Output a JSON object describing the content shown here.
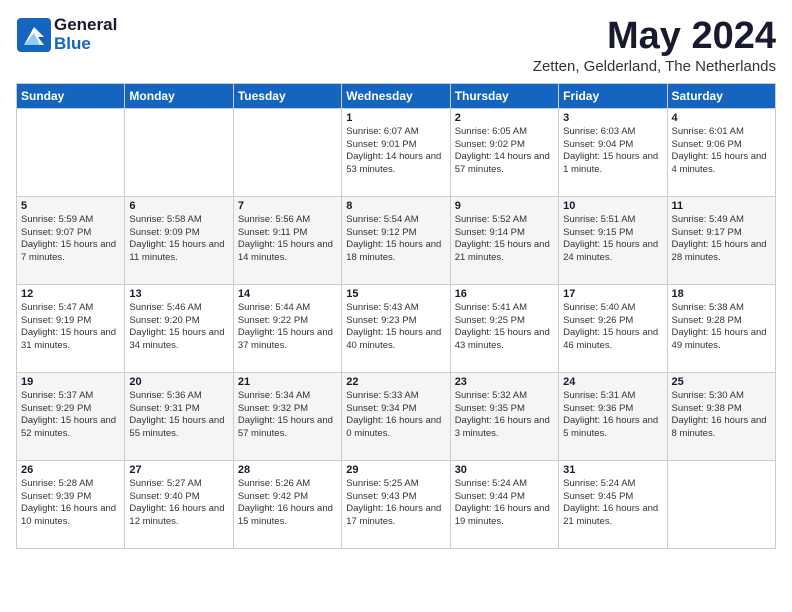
{
  "logo": {
    "general": "General",
    "blue": "Blue"
  },
  "title": "May 2024",
  "location": "Zetten, Gelderland, The Netherlands",
  "days_of_week": [
    "Sunday",
    "Monday",
    "Tuesday",
    "Wednesday",
    "Thursday",
    "Friday",
    "Saturday"
  ],
  "weeks": [
    [
      {
        "day": "",
        "info": ""
      },
      {
        "day": "",
        "info": ""
      },
      {
        "day": "",
        "info": ""
      },
      {
        "day": "1",
        "info": "Sunrise: 6:07 AM\nSunset: 9:01 PM\nDaylight: 14 hours and 53 minutes."
      },
      {
        "day": "2",
        "info": "Sunrise: 6:05 AM\nSunset: 9:02 PM\nDaylight: 14 hours and 57 minutes."
      },
      {
        "day": "3",
        "info": "Sunrise: 6:03 AM\nSunset: 9:04 PM\nDaylight: 15 hours and 1 minute."
      },
      {
        "day": "4",
        "info": "Sunrise: 6:01 AM\nSunset: 9:06 PM\nDaylight: 15 hours and 4 minutes."
      }
    ],
    [
      {
        "day": "5",
        "info": "Sunrise: 5:59 AM\nSunset: 9:07 PM\nDaylight: 15 hours and 7 minutes."
      },
      {
        "day": "6",
        "info": "Sunrise: 5:58 AM\nSunset: 9:09 PM\nDaylight: 15 hours and 11 minutes."
      },
      {
        "day": "7",
        "info": "Sunrise: 5:56 AM\nSunset: 9:11 PM\nDaylight: 15 hours and 14 minutes."
      },
      {
        "day": "8",
        "info": "Sunrise: 5:54 AM\nSunset: 9:12 PM\nDaylight: 15 hours and 18 minutes."
      },
      {
        "day": "9",
        "info": "Sunrise: 5:52 AM\nSunset: 9:14 PM\nDaylight: 15 hours and 21 minutes."
      },
      {
        "day": "10",
        "info": "Sunrise: 5:51 AM\nSunset: 9:15 PM\nDaylight: 15 hours and 24 minutes."
      },
      {
        "day": "11",
        "info": "Sunrise: 5:49 AM\nSunset: 9:17 PM\nDaylight: 15 hours and 28 minutes."
      }
    ],
    [
      {
        "day": "12",
        "info": "Sunrise: 5:47 AM\nSunset: 9:19 PM\nDaylight: 15 hours and 31 minutes."
      },
      {
        "day": "13",
        "info": "Sunrise: 5:46 AM\nSunset: 9:20 PM\nDaylight: 15 hours and 34 minutes."
      },
      {
        "day": "14",
        "info": "Sunrise: 5:44 AM\nSunset: 9:22 PM\nDaylight: 15 hours and 37 minutes."
      },
      {
        "day": "15",
        "info": "Sunrise: 5:43 AM\nSunset: 9:23 PM\nDaylight: 15 hours and 40 minutes."
      },
      {
        "day": "16",
        "info": "Sunrise: 5:41 AM\nSunset: 9:25 PM\nDaylight: 15 hours and 43 minutes."
      },
      {
        "day": "17",
        "info": "Sunrise: 5:40 AM\nSunset: 9:26 PM\nDaylight: 15 hours and 46 minutes."
      },
      {
        "day": "18",
        "info": "Sunrise: 5:38 AM\nSunset: 9:28 PM\nDaylight: 15 hours and 49 minutes."
      }
    ],
    [
      {
        "day": "19",
        "info": "Sunrise: 5:37 AM\nSunset: 9:29 PM\nDaylight: 15 hours and 52 minutes."
      },
      {
        "day": "20",
        "info": "Sunrise: 5:36 AM\nSunset: 9:31 PM\nDaylight: 15 hours and 55 minutes."
      },
      {
        "day": "21",
        "info": "Sunrise: 5:34 AM\nSunset: 9:32 PM\nDaylight: 15 hours and 57 minutes."
      },
      {
        "day": "22",
        "info": "Sunrise: 5:33 AM\nSunset: 9:34 PM\nDaylight: 16 hours and 0 minutes."
      },
      {
        "day": "23",
        "info": "Sunrise: 5:32 AM\nSunset: 9:35 PM\nDaylight: 16 hours and 3 minutes."
      },
      {
        "day": "24",
        "info": "Sunrise: 5:31 AM\nSunset: 9:36 PM\nDaylight: 16 hours and 5 minutes."
      },
      {
        "day": "25",
        "info": "Sunrise: 5:30 AM\nSunset: 9:38 PM\nDaylight: 16 hours and 8 minutes."
      }
    ],
    [
      {
        "day": "26",
        "info": "Sunrise: 5:28 AM\nSunset: 9:39 PM\nDaylight: 16 hours and 10 minutes."
      },
      {
        "day": "27",
        "info": "Sunrise: 5:27 AM\nSunset: 9:40 PM\nDaylight: 16 hours and 12 minutes."
      },
      {
        "day": "28",
        "info": "Sunrise: 5:26 AM\nSunset: 9:42 PM\nDaylight: 16 hours and 15 minutes."
      },
      {
        "day": "29",
        "info": "Sunrise: 5:25 AM\nSunset: 9:43 PM\nDaylight: 16 hours and 17 minutes."
      },
      {
        "day": "30",
        "info": "Sunrise: 5:24 AM\nSunset: 9:44 PM\nDaylight: 16 hours and 19 minutes."
      },
      {
        "day": "31",
        "info": "Sunrise: 5:24 AM\nSunset: 9:45 PM\nDaylight: 16 hours and 21 minutes."
      },
      {
        "day": "",
        "info": ""
      }
    ]
  ]
}
